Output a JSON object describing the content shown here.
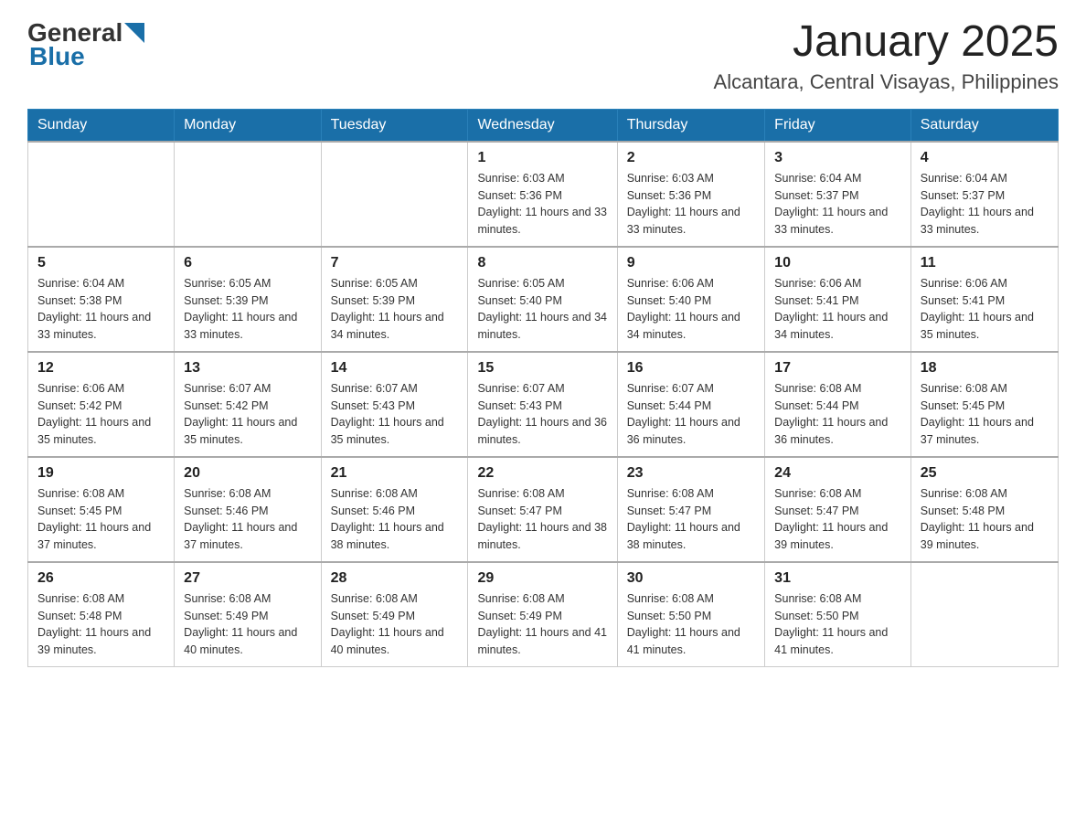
{
  "header": {
    "logo": {
      "text_general": "General",
      "text_blue": "Blue",
      "arrow": "▶"
    },
    "title": "January 2025",
    "location": "Alcantara, Central Visayas, Philippines"
  },
  "calendar": {
    "days_of_week": [
      "Sunday",
      "Monday",
      "Tuesday",
      "Wednesday",
      "Thursday",
      "Friday",
      "Saturday"
    ],
    "weeks": [
      [
        {
          "day": "",
          "info": ""
        },
        {
          "day": "",
          "info": ""
        },
        {
          "day": "",
          "info": ""
        },
        {
          "day": "1",
          "info": "Sunrise: 6:03 AM\nSunset: 5:36 PM\nDaylight: 11 hours and 33 minutes."
        },
        {
          "day": "2",
          "info": "Sunrise: 6:03 AM\nSunset: 5:36 PM\nDaylight: 11 hours and 33 minutes."
        },
        {
          "day": "3",
          "info": "Sunrise: 6:04 AM\nSunset: 5:37 PM\nDaylight: 11 hours and 33 minutes."
        },
        {
          "day": "4",
          "info": "Sunrise: 6:04 AM\nSunset: 5:37 PM\nDaylight: 11 hours and 33 minutes."
        }
      ],
      [
        {
          "day": "5",
          "info": "Sunrise: 6:04 AM\nSunset: 5:38 PM\nDaylight: 11 hours and 33 minutes."
        },
        {
          "day": "6",
          "info": "Sunrise: 6:05 AM\nSunset: 5:39 PM\nDaylight: 11 hours and 33 minutes."
        },
        {
          "day": "7",
          "info": "Sunrise: 6:05 AM\nSunset: 5:39 PM\nDaylight: 11 hours and 34 minutes."
        },
        {
          "day": "8",
          "info": "Sunrise: 6:05 AM\nSunset: 5:40 PM\nDaylight: 11 hours and 34 minutes."
        },
        {
          "day": "9",
          "info": "Sunrise: 6:06 AM\nSunset: 5:40 PM\nDaylight: 11 hours and 34 minutes."
        },
        {
          "day": "10",
          "info": "Sunrise: 6:06 AM\nSunset: 5:41 PM\nDaylight: 11 hours and 34 minutes."
        },
        {
          "day": "11",
          "info": "Sunrise: 6:06 AM\nSunset: 5:41 PM\nDaylight: 11 hours and 35 minutes."
        }
      ],
      [
        {
          "day": "12",
          "info": "Sunrise: 6:06 AM\nSunset: 5:42 PM\nDaylight: 11 hours and 35 minutes."
        },
        {
          "day": "13",
          "info": "Sunrise: 6:07 AM\nSunset: 5:42 PM\nDaylight: 11 hours and 35 minutes."
        },
        {
          "day": "14",
          "info": "Sunrise: 6:07 AM\nSunset: 5:43 PM\nDaylight: 11 hours and 35 minutes."
        },
        {
          "day": "15",
          "info": "Sunrise: 6:07 AM\nSunset: 5:43 PM\nDaylight: 11 hours and 36 minutes."
        },
        {
          "day": "16",
          "info": "Sunrise: 6:07 AM\nSunset: 5:44 PM\nDaylight: 11 hours and 36 minutes."
        },
        {
          "day": "17",
          "info": "Sunrise: 6:08 AM\nSunset: 5:44 PM\nDaylight: 11 hours and 36 minutes."
        },
        {
          "day": "18",
          "info": "Sunrise: 6:08 AM\nSunset: 5:45 PM\nDaylight: 11 hours and 37 minutes."
        }
      ],
      [
        {
          "day": "19",
          "info": "Sunrise: 6:08 AM\nSunset: 5:45 PM\nDaylight: 11 hours and 37 minutes."
        },
        {
          "day": "20",
          "info": "Sunrise: 6:08 AM\nSunset: 5:46 PM\nDaylight: 11 hours and 37 minutes."
        },
        {
          "day": "21",
          "info": "Sunrise: 6:08 AM\nSunset: 5:46 PM\nDaylight: 11 hours and 38 minutes."
        },
        {
          "day": "22",
          "info": "Sunrise: 6:08 AM\nSunset: 5:47 PM\nDaylight: 11 hours and 38 minutes."
        },
        {
          "day": "23",
          "info": "Sunrise: 6:08 AM\nSunset: 5:47 PM\nDaylight: 11 hours and 38 minutes."
        },
        {
          "day": "24",
          "info": "Sunrise: 6:08 AM\nSunset: 5:47 PM\nDaylight: 11 hours and 39 minutes."
        },
        {
          "day": "25",
          "info": "Sunrise: 6:08 AM\nSunset: 5:48 PM\nDaylight: 11 hours and 39 minutes."
        }
      ],
      [
        {
          "day": "26",
          "info": "Sunrise: 6:08 AM\nSunset: 5:48 PM\nDaylight: 11 hours and 39 minutes."
        },
        {
          "day": "27",
          "info": "Sunrise: 6:08 AM\nSunset: 5:49 PM\nDaylight: 11 hours and 40 minutes."
        },
        {
          "day": "28",
          "info": "Sunrise: 6:08 AM\nSunset: 5:49 PM\nDaylight: 11 hours and 40 minutes."
        },
        {
          "day": "29",
          "info": "Sunrise: 6:08 AM\nSunset: 5:49 PM\nDaylight: 11 hours and 41 minutes."
        },
        {
          "day": "30",
          "info": "Sunrise: 6:08 AM\nSunset: 5:50 PM\nDaylight: 11 hours and 41 minutes."
        },
        {
          "day": "31",
          "info": "Sunrise: 6:08 AM\nSunset: 5:50 PM\nDaylight: 11 hours and 41 minutes."
        },
        {
          "day": "",
          "info": ""
        }
      ]
    ]
  }
}
